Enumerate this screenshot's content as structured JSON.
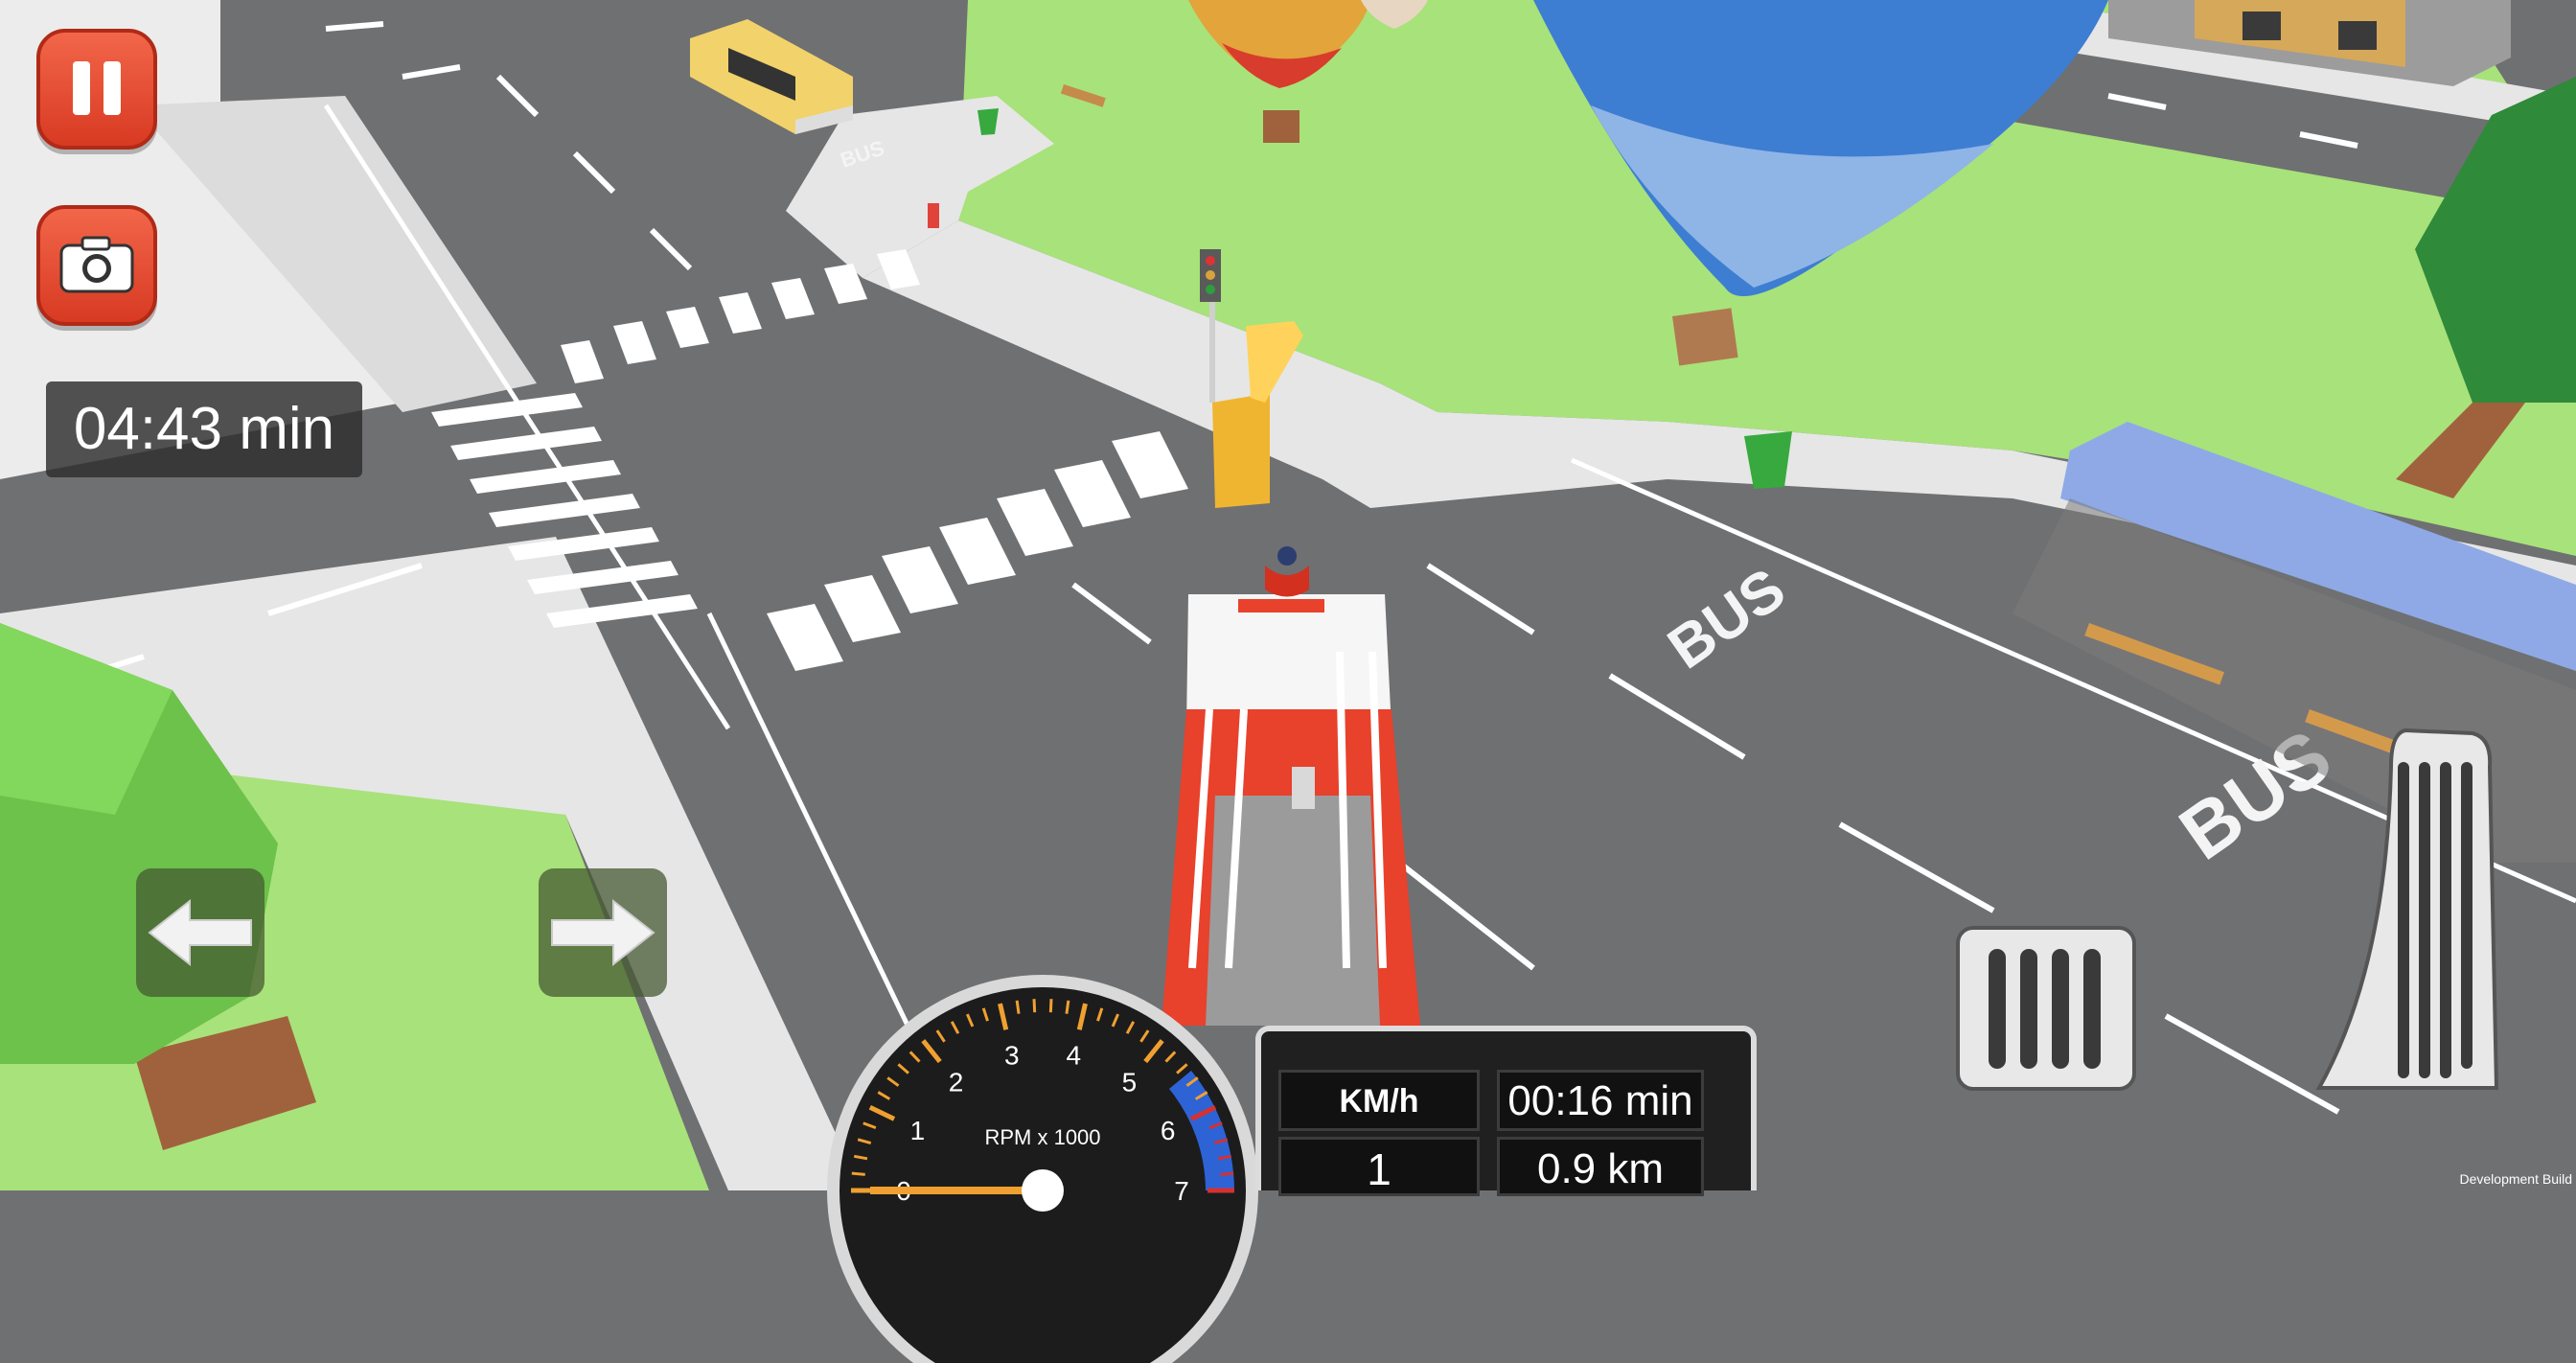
{
  "hud": {
    "pause_icon": "pause-icon",
    "camera_icon": "camera-icon",
    "remaining_time": "04:43 min",
    "left_icon": "arrow-left-icon",
    "right_icon": "arrow-right-icon"
  },
  "scene_text": {
    "bus_marking": "BUS"
  },
  "dashboard": {
    "rpm_label": "RPM x 1000",
    "rpm_ticks": [
      "0",
      "1",
      "2",
      "3",
      "4",
      "5",
      "6",
      "7"
    ],
    "rpm_value": 0,
    "speed_unit": "KM/h",
    "speed_value": "1",
    "elapsed_time": "00:16 min",
    "distance": "0.9 km"
  },
  "footer": {
    "build_label": "Development Build"
  },
  "colors": {
    "grass": "#a8e27a",
    "road": "#6f7072",
    "sidewalk": "#e8e8e8",
    "button_red": "#e14a30",
    "truck_red": "#e8412c"
  }
}
